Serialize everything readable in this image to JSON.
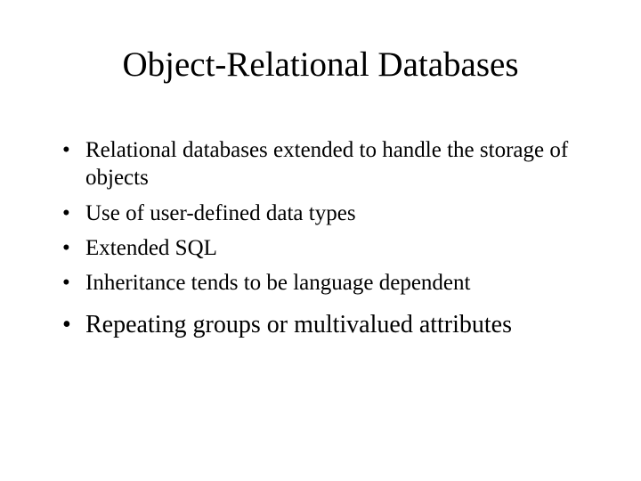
{
  "title": "Object-Relational Databases",
  "bullets": [
    "Relational databases extended to handle the storage of objects",
    "Use of user-defined data types",
    "Extended SQL",
    "Inheritance tends to be language dependent",
    "Repeating groups or multivalued attributes"
  ]
}
